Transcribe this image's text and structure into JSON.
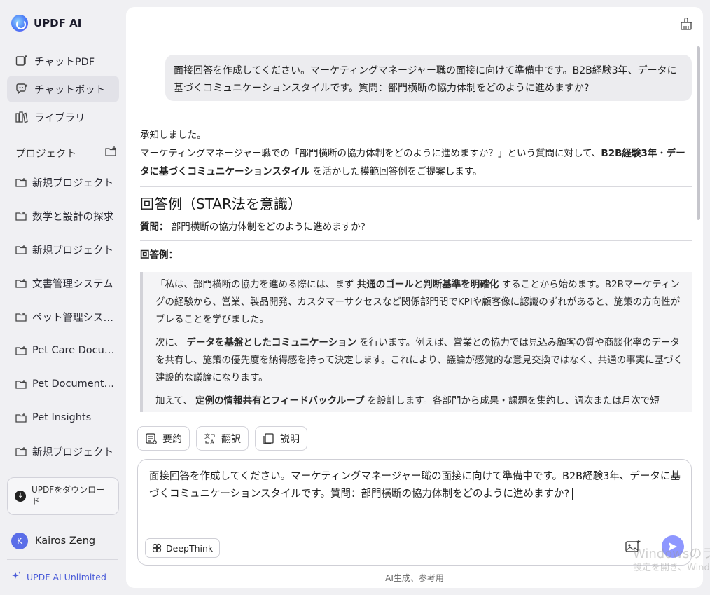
{
  "app": {
    "name": "UPDF AI"
  },
  "sidebar": {
    "nav": [
      {
        "label": "チャットPDF",
        "icon": "chat-pdf-icon"
      },
      {
        "label": "チャットボット",
        "icon": "chatbot-icon",
        "active": true
      },
      {
        "label": "ライブラリ",
        "icon": "library-icon"
      }
    ],
    "projects_header": "プロジェクト",
    "projects": [
      "新規プロジェクト",
      "数学と設計の探求",
      "新規プロジェクト",
      "文書管理システム",
      "ペット管理シス…",
      "Pet Care Docu…",
      "Pet Document…",
      "Pet Insights",
      "新規プロジェクト"
    ],
    "download_label": "UPDFをダウンロード",
    "user": {
      "initial": "K",
      "name": "Kairos Zeng"
    },
    "plan": "UPDF AI Unlimited"
  },
  "chat": {
    "user_message": "面接回答を作成してください。マーケティングマネージャー職の面接に向けて準備中です。B2B経験3年、データに基づくコミュニケーションスタイルです。質問：部門横断の協力体制をどのように進めますか?",
    "answer": {
      "intro": "承知しました。",
      "line2_a": "マーケティングマネージャー職での「部門横断の協力体制をどのように進めますか？」という質問に対して、",
      "line2_b": "B2B経験3年",
      "line2_c": "・",
      "line2_d": "データに基づくコミュニケーションスタイル",
      "line2_e": " を活かした模範回答例をご提案します。",
      "heading": "回答例（STAR法を意識）",
      "question_label": "質問：",
      "question_text": " 部門横断の協力体制をどのように進めますか?",
      "answer_label": "回答例：",
      "q1_a": "「私は、部門横断の協力を進める際には、まず ",
      "q1_b": "共通のゴールと判断基準を明確化",
      "q1_c": " することから始めます。B2Bマーケティングの経験から、営業、製品開発、カスタマーサクセスなど関係部門間でKPIや顧客像に認識のずれがあると、施策の方向性がブレることを学びました。",
      "q2_a": "次に、 ",
      "q2_b": "データを基盤としたコミュニケーション",
      "q2_c": " を行います。例えば、営業との協力では見込み顧客の質や商談化率のデータを共有し、施策の優先度を納得感を持って決定します。これにより、議論が感覚的な意見交換ではなく、共通の事実に基づく建設的な議論になります。",
      "q3_a": "加えて、 ",
      "q3_b": "定例の情報共有とフィードバックループ",
      "q3_c": " を設計します。各部門から成果・課題を集約し、週次または月次で短"
    },
    "actions": [
      {
        "label": "要約",
        "icon": "summarize-icon"
      },
      {
        "label": "翻訳",
        "icon": "translate-icon"
      },
      {
        "label": "説明",
        "icon": "explain-icon"
      }
    ],
    "input_value": "面接回答を作成してください。マーケティングマネージャー職の面接に向けて準備中です。B2B経験3年、データに基づくコミュニケーションスタイルです。質問：部門横断の協力体制をどのように進めますか?",
    "deepthink_label": "DeepThink",
    "footer_note": "AI生成、参考用"
  },
  "watermark": {
    "line1": "Windowsのラ",
    "line2": "設定を開き、Wind"
  },
  "colors": {
    "accent": "#4a5bd8",
    "send": "#8e97ff",
    "active_nav": "#e2e2e8"
  }
}
